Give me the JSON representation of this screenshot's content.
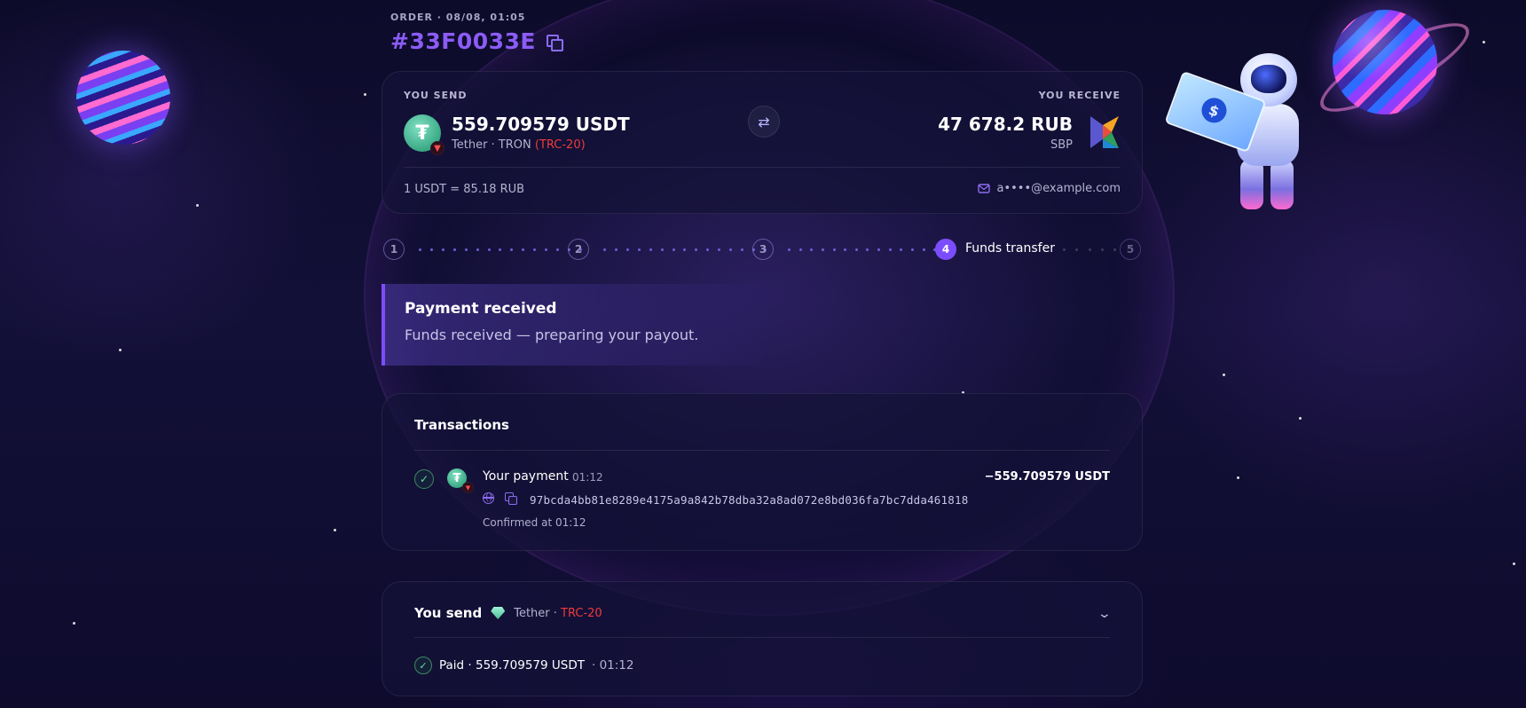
{
  "order": {
    "meta": "ORDER · 08/08, 01:05",
    "id": "#33F0033E"
  },
  "summary": {
    "send_label": "YOU SEND",
    "send_amount": "559.709579 USDT",
    "send_coin": "Tether · TRON",
    "send_network": "(TRC-20)",
    "receive_label": "YOU RECEIVE",
    "receive_amount": "47 678.2 RUB",
    "receive_method": "SBP",
    "rate": "1 USDT = 85.18 RUB",
    "email": "a••••@example.com"
  },
  "steps": {
    "items": [
      "1",
      "2",
      "3",
      "4",
      "5"
    ],
    "active_index": 3,
    "active_label": "Funds transfer"
  },
  "alert": {
    "title": "Payment received",
    "text": "Funds received — preparing your payout."
  },
  "transactions": {
    "title": "Transactions",
    "items": [
      {
        "title": "Your payment",
        "time": "01:12",
        "amount": "−559.709579 USDT",
        "hash": "97bcda4bb81e8289e4175a9a842b78dba32a8ad072e8bd036fa7bc7dda461818",
        "confirmed": "Confirmed at 01:12"
      }
    ]
  },
  "send_section": {
    "title": "You send",
    "coin": "Tether ·",
    "network": "TRC-20",
    "paid": "Paid · 559.709579 USDT",
    "paid_time": "· 01:12"
  },
  "icons": {
    "copy": "copy-icon",
    "swap": "swap-icon",
    "mail": "mail-icon",
    "check": "check-icon",
    "globe": "globe-icon",
    "chevron": "chevron-down-icon"
  },
  "colors": {
    "accent": "#7c4dff",
    "order_id": "#8b5cf6",
    "network_red": "#ef3b3b",
    "success": "#5ee0a0"
  }
}
